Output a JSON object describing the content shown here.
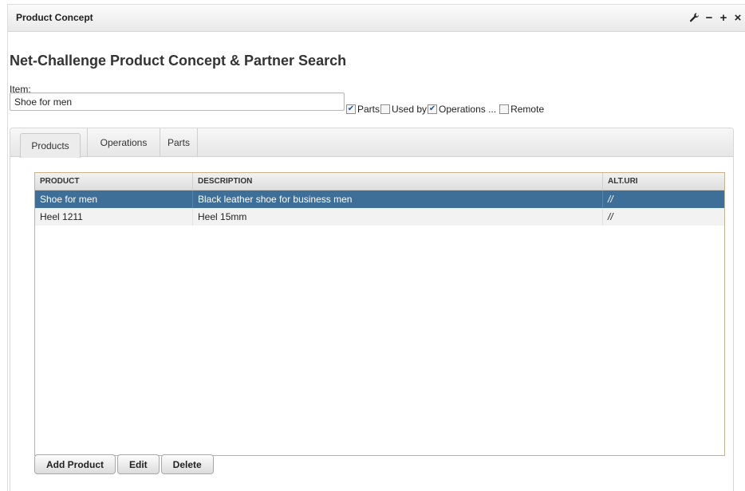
{
  "window": {
    "title": "Product Concept",
    "controls": {
      "settings": "🔧",
      "minimize": "−",
      "maximize": "+",
      "close": "×"
    }
  },
  "heading": "Net-Challenge Product Concept & Partner Search",
  "item": {
    "label": "Item:",
    "value": "Shoe for men"
  },
  "options": [
    {
      "label": "Parts",
      "checked": true
    },
    {
      "label": "Used by",
      "checked": false
    },
    {
      "label": "Operations ...",
      "checked": true
    },
    {
      "label": "Remote",
      "checked": false
    }
  ],
  "tabs": [
    {
      "label": "Products",
      "active": true
    },
    {
      "label": "Operations",
      "active": false
    },
    {
      "label": "Parts",
      "active": false
    }
  ],
  "table": {
    "columns": [
      "PRODUCT",
      "DESCRIPTION",
      "ALT.URI"
    ],
    "rows": [
      {
        "product": "Shoe for men",
        "description": "Black leather shoe for business men",
        "uri": "//",
        "selected": true
      },
      {
        "product": "Heel 1211",
        "description": "Heel 15mm",
        "uri": "//",
        "selected": false
      }
    ]
  },
  "buttons": {
    "add": "Add Product",
    "edit": "Edit",
    "delete": "Delete"
  },
  "colors": {
    "selection": "#3e6f98",
    "grid_border": "#c9b28a"
  }
}
